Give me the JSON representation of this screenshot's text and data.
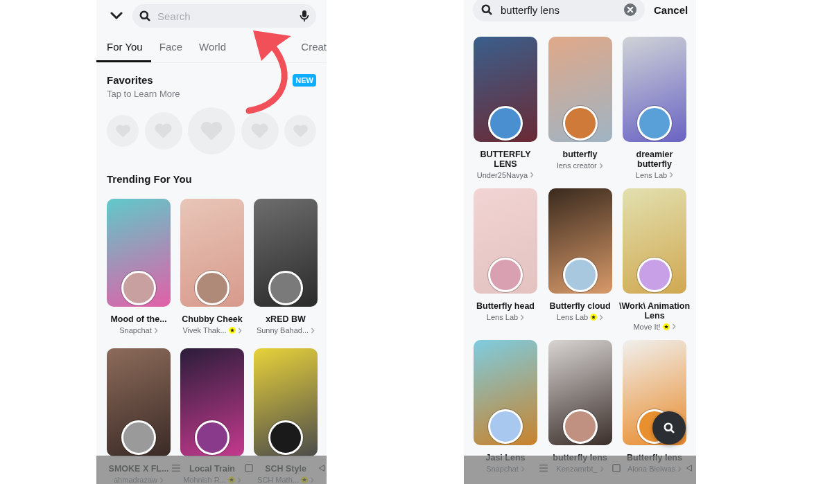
{
  "left_screen": {
    "search": {
      "placeholder": "Search"
    },
    "tabs": [
      {
        "label": "For You",
        "selected": true
      },
      {
        "label": "Face",
        "selected": false
      },
      {
        "label": "World",
        "selected": false
      },
      {
        "label": "Creat",
        "selected": false
      }
    ],
    "favorites": {
      "title": "Favorites",
      "subtitle": "Tap to Learn More",
      "badge": "NEW"
    },
    "section_title": "Trending For You",
    "lenses": [
      {
        "title": "Mood of the...",
        "creator": "Snapchat",
        "verified": false
      },
      {
        "title": "Chubby Cheek",
        "creator": "Vivek Thak...",
        "verified": true
      },
      {
        "title": "xRED BW",
        "creator": "Sunny Bahad...",
        "verified": false
      },
      {
        "title": "SMOKE X FL...",
        "creator": "ahmadrazaw",
        "verified": false
      },
      {
        "title": "Local Train",
        "creator": "Mohnish R...",
        "verified": true
      },
      {
        "title": "SCH Style",
        "creator": "SCH Math...",
        "verified": true
      }
    ]
  },
  "right_screen": {
    "search": {
      "value": "butterfly lens"
    },
    "cancel": "Cancel",
    "lenses": [
      {
        "title": "BUTTERFLY LENS",
        "creator": "Under25Navya",
        "verified": false
      },
      {
        "title": "butterfly",
        "creator": "lens creator",
        "verified": false
      },
      {
        "title": "dreamier butterfly",
        "creator": "Lens Lab",
        "verified": false
      },
      {
        "title": "Butterfly head",
        "creator": "Lens Lab",
        "verified": false
      },
      {
        "title": "Butterfly cloud",
        "creator": "Lens Lab",
        "verified": true
      },
      {
        "title": "\\Work\\ Animation Lens",
        "creator": "Move It!",
        "verified": true
      },
      {
        "title": "Jasi Lens",
        "creator": "Snapchat",
        "verified": false
      },
      {
        "title": "butterfly lens",
        "creator": "Kenzamrbt_",
        "verified": false
      },
      {
        "title": "Butterfly lens",
        "creator": "Alona Bleiwas",
        "verified": false
      }
    ]
  }
}
